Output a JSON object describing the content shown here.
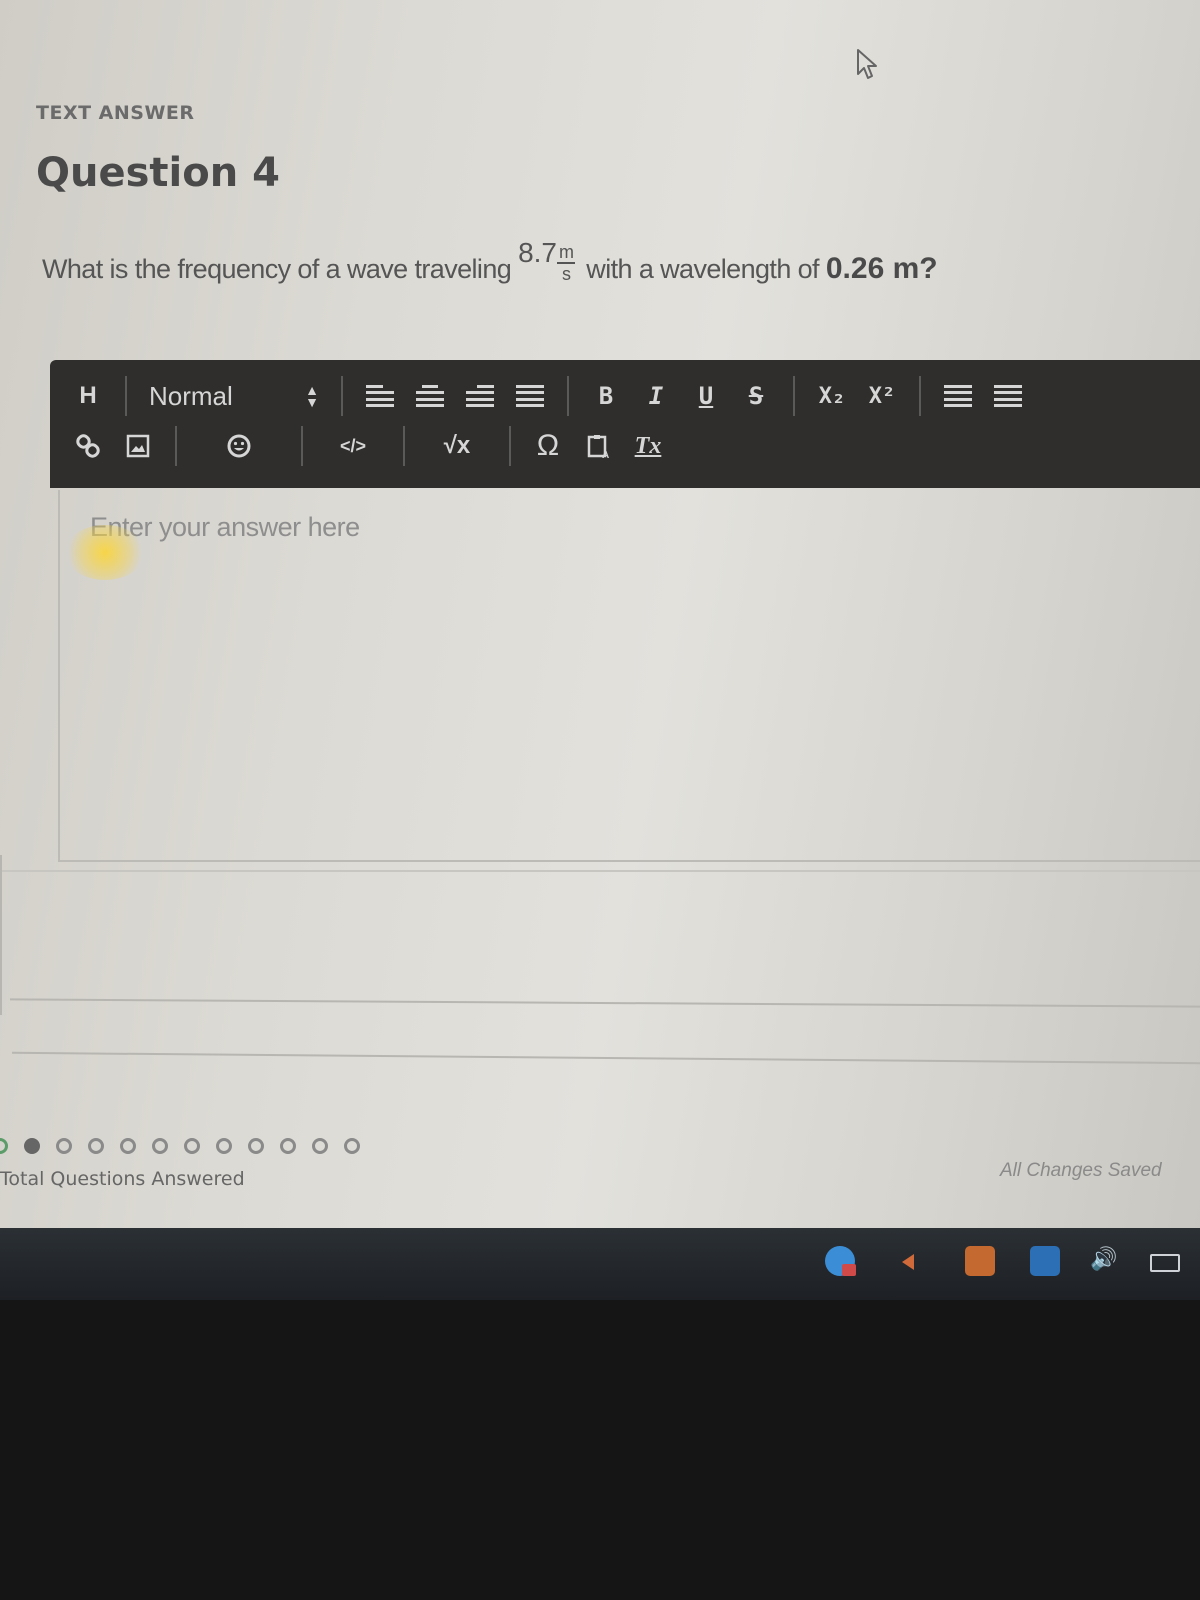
{
  "section_label": "TEXT ANSWER",
  "question": {
    "title": "Question 4",
    "text_before": "What is the frequency of a wave traveling ",
    "speed_value": "8.7",
    "speed_unit_numerator": "m",
    "speed_unit_denominator": "s",
    "text_middle": " with a wavelength of ",
    "wavelength": "0.26 m?"
  },
  "toolbar": {
    "row1": {
      "heading": "H",
      "format_select": "Normal",
      "align_buttons": [
        "align-left",
        "align-center",
        "align-right",
        "align-justify"
      ],
      "bold": "B",
      "italic": "I",
      "underline": "U",
      "strike": "S",
      "subscript": "X₂",
      "superscript": "X²",
      "lists": [
        "ordered-list",
        "bullet-list"
      ]
    },
    "row2": {
      "code": "</>",
      "formula": "√x",
      "special_char": "Ω",
      "clear_format": "Tx"
    }
  },
  "editor": {
    "placeholder": "Enter your answer here",
    "value": ""
  },
  "progress": {
    "label": "Total Questions Answered",
    "total_dots": 12,
    "answered": 1,
    "current_index": 0
  },
  "save_status": "All Changes Saved",
  "taskbar": {
    "tray_icons": [
      "skype-icon",
      "arrow-icon",
      "java-icon",
      "k-app-icon",
      "volume-icon",
      "battery-icon"
    ]
  }
}
